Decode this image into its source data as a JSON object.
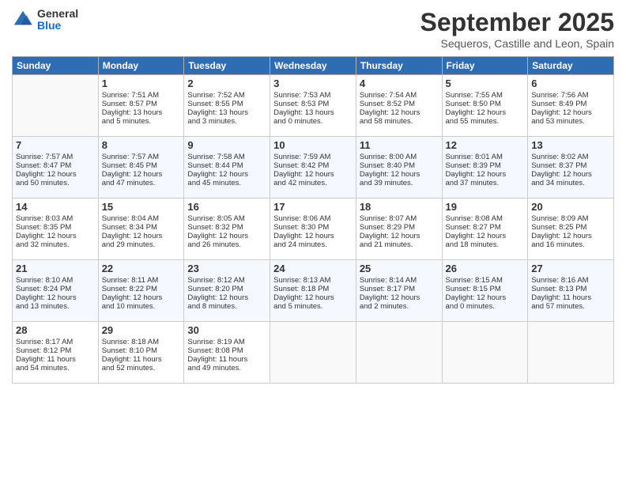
{
  "logo": {
    "general": "General",
    "blue": "Blue"
  },
  "header": {
    "month": "September 2025",
    "location": "Sequeros, Castille and Leon, Spain"
  },
  "weekdays": [
    "Sunday",
    "Monday",
    "Tuesday",
    "Wednesday",
    "Thursday",
    "Friday",
    "Saturday"
  ],
  "weeks": [
    [
      {
        "day": "",
        "lines": []
      },
      {
        "day": "1",
        "lines": [
          "Sunrise: 7:51 AM",
          "Sunset: 8:57 PM",
          "Daylight: 13 hours",
          "and 5 minutes."
        ]
      },
      {
        "day": "2",
        "lines": [
          "Sunrise: 7:52 AM",
          "Sunset: 8:55 PM",
          "Daylight: 13 hours",
          "and 3 minutes."
        ]
      },
      {
        "day": "3",
        "lines": [
          "Sunrise: 7:53 AM",
          "Sunset: 8:53 PM",
          "Daylight: 13 hours",
          "and 0 minutes."
        ]
      },
      {
        "day": "4",
        "lines": [
          "Sunrise: 7:54 AM",
          "Sunset: 8:52 PM",
          "Daylight: 12 hours",
          "and 58 minutes."
        ]
      },
      {
        "day": "5",
        "lines": [
          "Sunrise: 7:55 AM",
          "Sunset: 8:50 PM",
          "Daylight: 12 hours",
          "and 55 minutes."
        ]
      },
      {
        "day": "6",
        "lines": [
          "Sunrise: 7:56 AM",
          "Sunset: 8:49 PM",
          "Daylight: 12 hours",
          "and 53 minutes."
        ]
      }
    ],
    [
      {
        "day": "7",
        "lines": [
          "Sunrise: 7:57 AM",
          "Sunset: 8:47 PM",
          "Daylight: 12 hours",
          "and 50 minutes."
        ]
      },
      {
        "day": "8",
        "lines": [
          "Sunrise: 7:57 AM",
          "Sunset: 8:45 PM",
          "Daylight: 12 hours",
          "and 47 minutes."
        ]
      },
      {
        "day": "9",
        "lines": [
          "Sunrise: 7:58 AM",
          "Sunset: 8:44 PM",
          "Daylight: 12 hours",
          "and 45 minutes."
        ]
      },
      {
        "day": "10",
        "lines": [
          "Sunrise: 7:59 AM",
          "Sunset: 8:42 PM",
          "Daylight: 12 hours",
          "and 42 minutes."
        ]
      },
      {
        "day": "11",
        "lines": [
          "Sunrise: 8:00 AM",
          "Sunset: 8:40 PM",
          "Daylight: 12 hours",
          "and 39 minutes."
        ]
      },
      {
        "day": "12",
        "lines": [
          "Sunrise: 8:01 AM",
          "Sunset: 8:39 PM",
          "Daylight: 12 hours",
          "and 37 minutes."
        ]
      },
      {
        "day": "13",
        "lines": [
          "Sunrise: 8:02 AM",
          "Sunset: 8:37 PM",
          "Daylight: 12 hours",
          "and 34 minutes."
        ]
      }
    ],
    [
      {
        "day": "14",
        "lines": [
          "Sunrise: 8:03 AM",
          "Sunset: 8:35 PM",
          "Daylight: 12 hours",
          "and 32 minutes."
        ]
      },
      {
        "day": "15",
        "lines": [
          "Sunrise: 8:04 AM",
          "Sunset: 8:34 PM",
          "Daylight: 12 hours",
          "and 29 minutes."
        ]
      },
      {
        "day": "16",
        "lines": [
          "Sunrise: 8:05 AM",
          "Sunset: 8:32 PM",
          "Daylight: 12 hours",
          "and 26 minutes."
        ]
      },
      {
        "day": "17",
        "lines": [
          "Sunrise: 8:06 AM",
          "Sunset: 8:30 PM",
          "Daylight: 12 hours",
          "and 24 minutes."
        ]
      },
      {
        "day": "18",
        "lines": [
          "Sunrise: 8:07 AM",
          "Sunset: 8:29 PM",
          "Daylight: 12 hours",
          "and 21 minutes."
        ]
      },
      {
        "day": "19",
        "lines": [
          "Sunrise: 8:08 AM",
          "Sunset: 8:27 PM",
          "Daylight: 12 hours",
          "and 18 minutes."
        ]
      },
      {
        "day": "20",
        "lines": [
          "Sunrise: 8:09 AM",
          "Sunset: 8:25 PM",
          "Daylight: 12 hours",
          "and 16 minutes."
        ]
      }
    ],
    [
      {
        "day": "21",
        "lines": [
          "Sunrise: 8:10 AM",
          "Sunset: 8:24 PM",
          "Daylight: 12 hours",
          "and 13 minutes."
        ]
      },
      {
        "day": "22",
        "lines": [
          "Sunrise: 8:11 AM",
          "Sunset: 8:22 PM",
          "Daylight: 12 hours",
          "and 10 minutes."
        ]
      },
      {
        "day": "23",
        "lines": [
          "Sunrise: 8:12 AM",
          "Sunset: 8:20 PM",
          "Daylight: 12 hours",
          "and 8 minutes."
        ]
      },
      {
        "day": "24",
        "lines": [
          "Sunrise: 8:13 AM",
          "Sunset: 8:18 PM",
          "Daylight: 12 hours",
          "and 5 minutes."
        ]
      },
      {
        "day": "25",
        "lines": [
          "Sunrise: 8:14 AM",
          "Sunset: 8:17 PM",
          "Daylight: 12 hours",
          "and 2 minutes."
        ]
      },
      {
        "day": "26",
        "lines": [
          "Sunrise: 8:15 AM",
          "Sunset: 8:15 PM",
          "Daylight: 12 hours",
          "and 0 minutes."
        ]
      },
      {
        "day": "27",
        "lines": [
          "Sunrise: 8:16 AM",
          "Sunset: 8:13 PM",
          "Daylight: 11 hours",
          "and 57 minutes."
        ]
      }
    ],
    [
      {
        "day": "28",
        "lines": [
          "Sunrise: 8:17 AM",
          "Sunset: 8:12 PM",
          "Daylight: 11 hours",
          "and 54 minutes."
        ]
      },
      {
        "day": "29",
        "lines": [
          "Sunrise: 8:18 AM",
          "Sunset: 8:10 PM",
          "Daylight: 11 hours",
          "and 52 minutes."
        ]
      },
      {
        "day": "30",
        "lines": [
          "Sunrise: 8:19 AM",
          "Sunset: 8:08 PM",
          "Daylight: 11 hours",
          "and 49 minutes."
        ]
      },
      {
        "day": "",
        "lines": []
      },
      {
        "day": "",
        "lines": []
      },
      {
        "day": "",
        "lines": []
      },
      {
        "day": "",
        "lines": []
      }
    ]
  ]
}
